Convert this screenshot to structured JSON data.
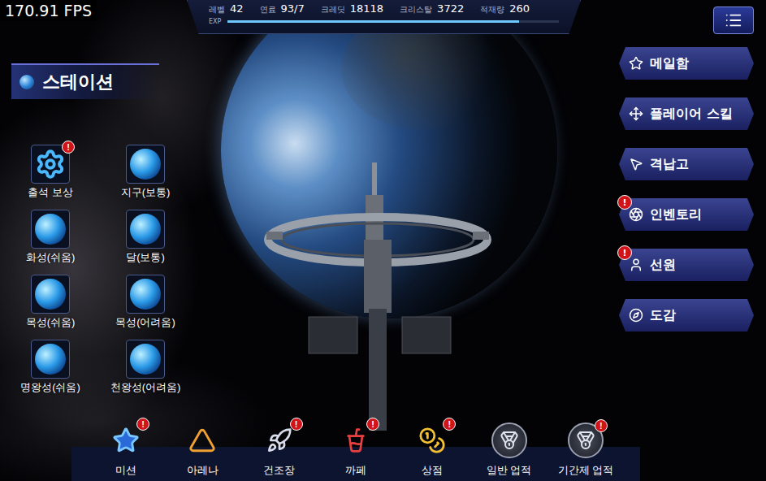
{
  "fps": "170.91 FPS",
  "stats": [
    {
      "label": "레벨",
      "value": "42"
    },
    {
      "label": "연료",
      "value": "93/7"
    },
    {
      "label": "크레딧",
      "value": "18118"
    },
    {
      "label": "크리스탈",
      "value": "3722"
    },
    {
      "label": "적재량",
      "value": "260"
    }
  ],
  "exp": {
    "label": "EXP",
    "level": 0.88
  },
  "badge": "!",
  "station": {
    "title": "스테이션"
  },
  "stages": [
    {
      "label": "출석 보상",
      "kind": "gear",
      "alert": true
    },
    {
      "label": "지구(보통)",
      "kind": "planet",
      "alert": false
    },
    {
      "label": "화성(쉬움)",
      "kind": "planet",
      "alert": false
    },
    {
      "label": "달(보통)",
      "kind": "planet",
      "alert": false
    },
    {
      "label": "목성(쉬움)",
      "kind": "planet",
      "alert": false
    },
    {
      "label": "목성(어려움)",
      "kind": "planet",
      "alert": false
    },
    {
      "label": "명왕성(쉬움)",
      "kind": "planet",
      "alert": false
    },
    {
      "label": "천왕성(어려움)",
      "kind": "planet",
      "alert": false
    }
  ],
  "side_menu": [
    {
      "label": "메일함",
      "alert": false
    },
    {
      "label": "플레이어 스킬",
      "alert": false
    },
    {
      "label": "격납고",
      "alert": false
    },
    {
      "label": "인벤토리",
      "alert": true
    },
    {
      "label": "선원",
      "alert": true
    },
    {
      "label": "도감",
      "alert": false
    }
  ],
  "bottom_menu": [
    {
      "label": "미션",
      "alert": true
    },
    {
      "label": "아레나",
      "alert": false
    },
    {
      "label": "건조장",
      "alert": true
    },
    {
      "label": "까페",
      "alert": true
    },
    {
      "label": "상점",
      "alert": true
    },
    {
      "label": "일반 업적",
      "alert": false
    },
    {
      "label": "기간제 업적",
      "alert": true
    }
  ]
}
